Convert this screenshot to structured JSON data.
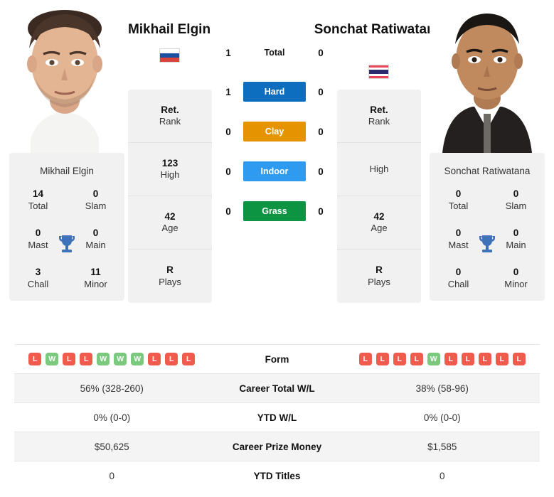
{
  "players": {
    "left": {
      "name": "Mikhail Elgin",
      "card_name": "Mikhail Elgin",
      "flag": "russia-flag",
      "titles": [
        {
          "value": "14",
          "label": "Total"
        },
        {
          "value": "0",
          "label": "Slam"
        },
        {
          "value": "0",
          "label": "Mast"
        },
        {
          "value": "0",
          "label": "Main"
        },
        {
          "value": "3",
          "label": "Chall"
        },
        {
          "value": "11",
          "label": "Minor"
        }
      ],
      "info": [
        {
          "value": "Ret.",
          "label": "Rank"
        },
        {
          "value": "123",
          "label": "High"
        },
        {
          "value": "42",
          "label": "Age"
        },
        {
          "value": "R",
          "label": "Plays"
        }
      ],
      "form": [
        "L",
        "W",
        "L",
        "L",
        "W",
        "W",
        "W",
        "L",
        "L",
        "L"
      ]
    },
    "right": {
      "name": "Sonchat Ratiwatana",
      "card_name": "Sonchat Ratiwatana",
      "flag": "thailand-flag",
      "titles": [
        {
          "value": "0",
          "label": "Total"
        },
        {
          "value": "0",
          "label": "Slam"
        },
        {
          "value": "0",
          "label": "Mast"
        },
        {
          "value": "0",
          "label": "Main"
        },
        {
          "value": "0",
          "label": "Chall"
        },
        {
          "value": "0",
          "label": "Minor"
        }
      ],
      "info": [
        {
          "value": "Ret.",
          "label": "Rank"
        },
        {
          "value": "",
          "label": "High"
        },
        {
          "value": "42",
          "label": "Age"
        },
        {
          "value": "R",
          "label": "Plays"
        }
      ],
      "form": [
        "L",
        "L",
        "L",
        "L",
        "W",
        "L",
        "L",
        "L",
        "L",
        "L"
      ]
    }
  },
  "surfaces": [
    {
      "label": "Total",
      "left": "1",
      "right": "0",
      "color": "transparent",
      "text_color": "#111111"
    },
    {
      "label": "Hard",
      "left": "1",
      "right": "0",
      "color": "#0d6ebf",
      "text_color": "#ffffff"
    },
    {
      "label": "Clay",
      "left": "0",
      "right": "0",
      "color": "#e59400",
      "text_color": "#ffffff"
    },
    {
      "label": "Indoor",
      "left": "0",
      "right": "0",
      "color": "#2e9bf0",
      "text_color": "#ffffff"
    },
    {
      "label": "Grass",
      "left": "0",
      "right": "0",
      "color": "#0d9443",
      "text_color": "#ffffff"
    }
  ],
  "table": {
    "form_label": "Form",
    "rows": [
      {
        "left": "56% (328-260)",
        "label": "Career Total W/L",
        "right": "38% (58-96)"
      },
      {
        "left": "0% (0-0)",
        "label": "YTD W/L",
        "right": "0% (0-0)"
      },
      {
        "left": "$50,625",
        "label": "Career Prize Money",
        "right": "$1,585"
      },
      {
        "left": "0",
        "label": "YTD Titles",
        "right": "0"
      }
    ]
  },
  "colors": {
    "win_badge": "#7ac97f",
    "loss_badge": "#ef5b4c",
    "card_bg": "#f1f1f1",
    "row_alt_bg": "#f4f4f4",
    "trophy": "#3f72b8"
  }
}
